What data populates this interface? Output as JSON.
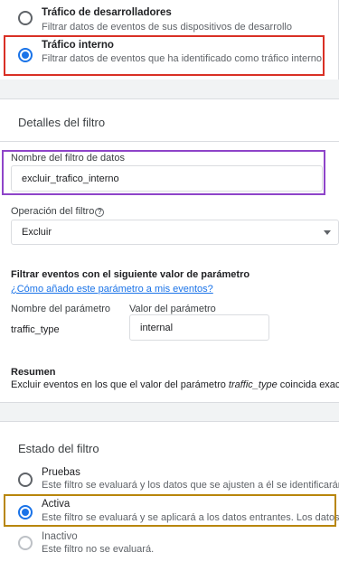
{
  "traffic_options": [
    {
      "title": "Tráfico de desarrolladores",
      "desc": "Filtrar datos de eventos de sus dispositivos de desarrollo",
      "checked": false
    },
    {
      "title": "Tráfico interno",
      "desc": "Filtrar datos de eventos que ha identificado como tráfico interno",
      "checked": true
    }
  ],
  "details": {
    "title": "Detalles del filtro",
    "name_label": "Nombre del filtro de datos",
    "name_value": "excluir_trafico_interno",
    "operation_label": "Operación del filtro",
    "operation_value": "Excluir",
    "param_heading": "Filtrar eventos con el siguiente valor de parámetro",
    "param_link": "¿Cómo añado este parámetro a mis eventos?",
    "param_name_label": "Nombre del parámetro",
    "param_value_label": "Valor del parámetro",
    "param_name": "traffic_type",
    "param_value": "internal",
    "summary_title": "Resumen",
    "summary_pre": "Excluir eventos en los que el valor del parámetro ",
    "summary_param": "traffic_type",
    "summary_post": " coincida exactan"
  },
  "state": {
    "title": "Estado del filtro",
    "options": [
      {
        "title": "Pruebas",
        "desc": "Este filtro se evaluará y los datos que se ajusten a él se identificarán co",
        "checked": false
      },
      {
        "title": "Activa",
        "desc": "Este filtro se evaluará y se aplicará a los datos entrantes. Los datos qu",
        "checked": true
      },
      {
        "title": "Inactivo",
        "desc": "Este filtro no se evaluará.",
        "checked": false,
        "disabled": true
      }
    ]
  },
  "colors": {
    "accent": "#1a73e8",
    "highlight_red": "#d93025",
    "highlight_purple": "#8e44c9",
    "highlight_gold": "#b8860b"
  }
}
